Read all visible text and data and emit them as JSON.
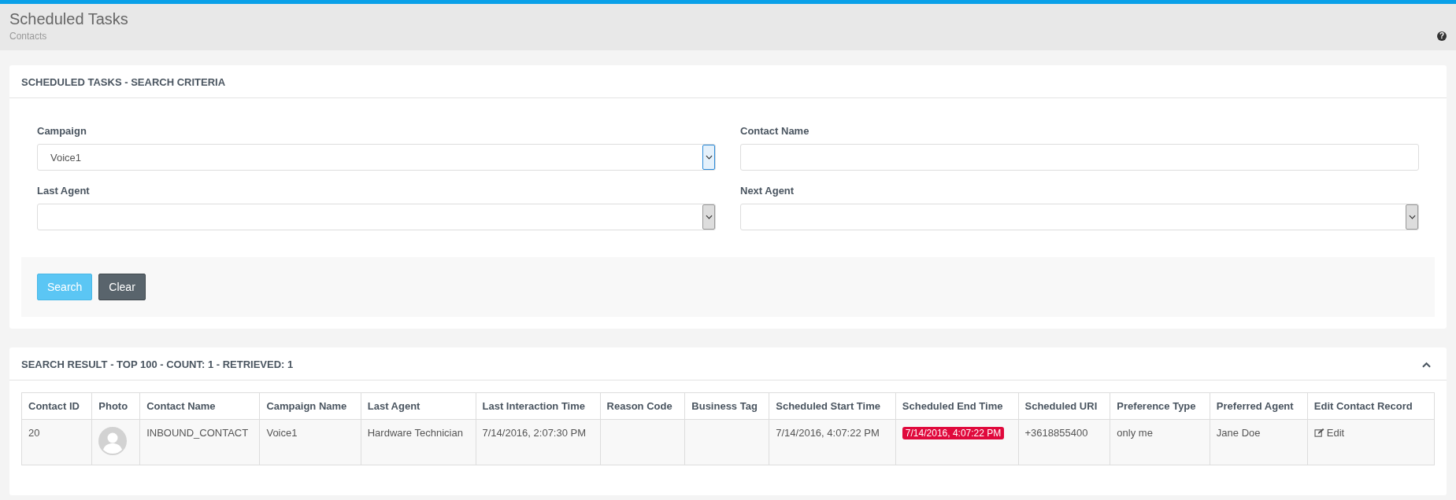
{
  "header": {
    "title": "Scheduled Tasks",
    "subtitle": "Contacts",
    "help": "?"
  },
  "criteria": {
    "title": "SCHEDULED TASKS - SEARCH CRITERIA",
    "fields": [
      {
        "label": "Campaign",
        "kind": "select",
        "value": "Voice1",
        "focused": true
      },
      {
        "label": "Contact Name",
        "kind": "text",
        "focused": false
      },
      {
        "label": "Last Agent",
        "kind": "select",
        "focused": false
      },
      {
        "label": "Next Agent",
        "kind": "select",
        "focused": false
      }
    ],
    "buttons": [
      {
        "label": "Search",
        "kind": "primary"
      },
      {
        "label": "Clear",
        "kind": "secondary"
      }
    ]
  },
  "results": {
    "title": "SEARCH RESULT - TOP 100 - COUNT: 1 - RETRIEVED: 1",
    "expanded": true,
    "columns": [
      "Contact ID",
      "Photo",
      "Contact Name",
      "Campaign Name",
      "Last Agent",
      "Last Interaction Time",
      "Reason Code",
      "Business Tag",
      "Scheduled Start Time",
      "Scheduled End Time",
      "Scheduled URI",
      "Preference Type",
      "Preferred Agent",
      "Edit Contact Record"
    ],
    "rows": [
      {
        "cells": [
          {
            "kind": "text",
            "text": "20"
          },
          {
            "kind": "photo"
          },
          {
            "kind": "text",
            "text": "INBOUND_CONTACT"
          },
          {
            "kind": "text",
            "text": "Voice1"
          },
          {
            "kind": "text",
            "text": "Hardware Technician"
          },
          {
            "kind": "text",
            "text": "7/14/2016, 2:07:30 PM"
          },
          {
            "kind": "text"
          },
          {
            "kind": "text"
          },
          {
            "kind": "text",
            "text": "7/14/2016, 4:07:22 PM"
          },
          {
            "kind": "badge",
            "text": "7/14/2016, 4:07:22 PM"
          },
          {
            "kind": "text",
            "text": "+3618855400"
          },
          {
            "kind": "text",
            "text": "only me"
          },
          {
            "kind": "text",
            "text": "Jane Doe"
          },
          {
            "kind": "edit",
            "text": "Edit"
          }
        ]
      }
    ]
  }
}
